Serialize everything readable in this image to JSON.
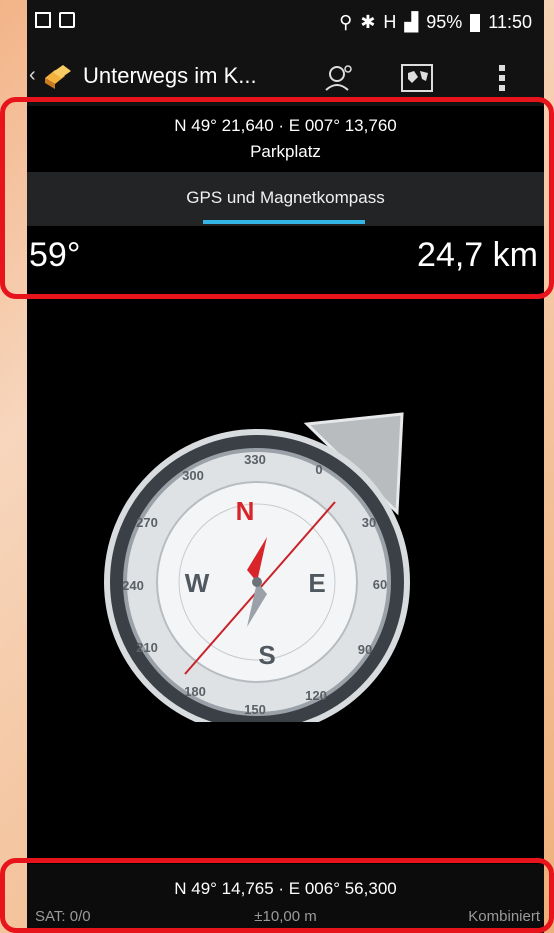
{
  "statusbar": {
    "battery": "95%",
    "time": "11:50",
    "network": "H"
  },
  "actionbar": {
    "title": "Unterwegs im K...",
    "icons": [
      "back-chevron-icon",
      "app-logo-icon",
      "person-pin-icon",
      "map-icon",
      "overflow-menu-icon"
    ]
  },
  "target": {
    "coordinates": "N 49° 21,640 · E 007° 13,760",
    "name": "Parkplatz",
    "mode": "GPS und Magnetkompass",
    "bearing": "59°",
    "distance": "24,7 km"
  },
  "compass": {
    "cardinals": [
      "N",
      "E",
      "S",
      "W"
    ],
    "outer_ticks": [
      "0",
      "30",
      "60",
      "90",
      "120",
      "150",
      "180",
      "210",
      "240",
      "270",
      "300",
      "330"
    ]
  },
  "footer": {
    "coordinates": "N 49° 14,765 · E 006° 56,300",
    "sat": "SAT: 0/0",
    "accuracy": "±10,00 m",
    "source": "Kombiniert"
  },
  "colors": {
    "accent": "#33b5e5",
    "highlight": "#e8141b",
    "background_gradient": "#f3b488"
  }
}
